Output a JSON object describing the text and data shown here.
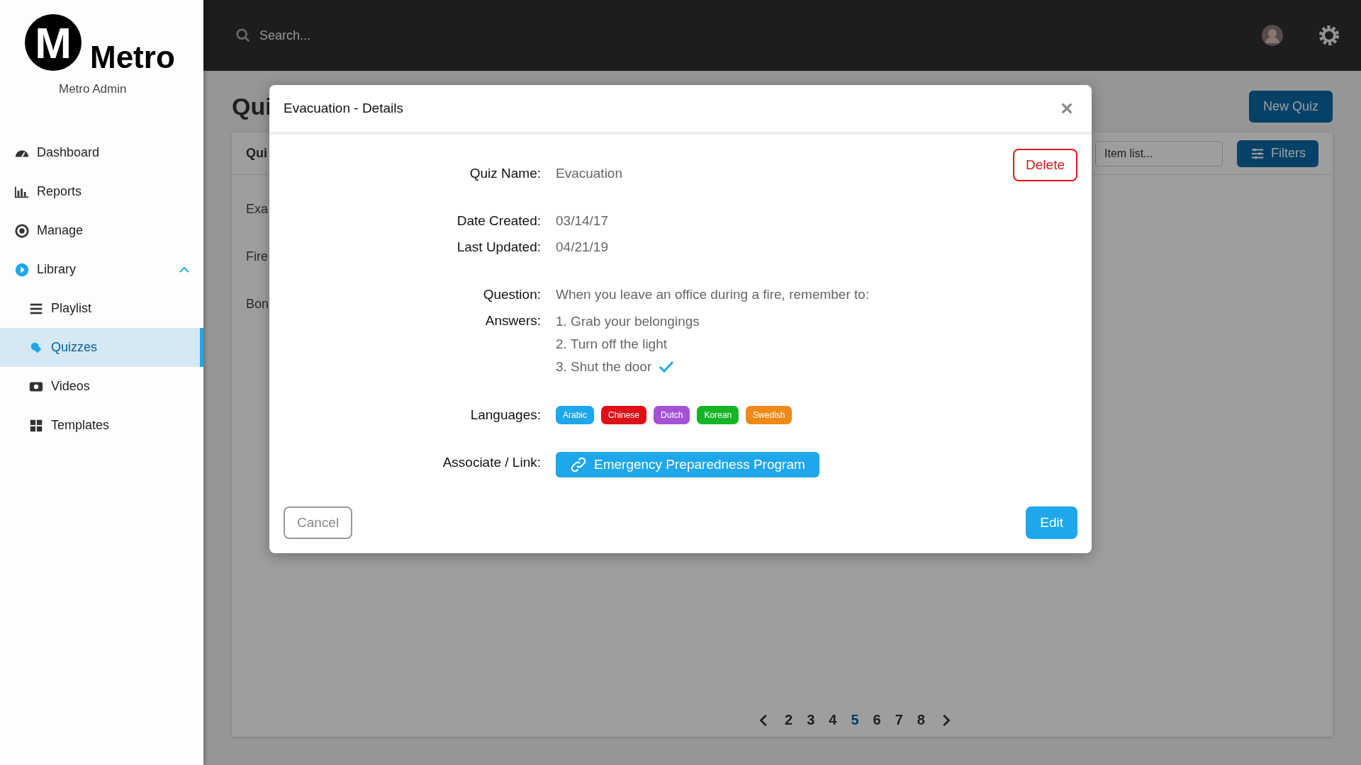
{
  "sidebar": {
    "logo_mark": "M",
    "logo_text": "Metro",
    "subtitle": "Metro Admin",
    "items": [
      {
        "label": "Dashboard",
        "selected": false
      },
      {
        "label": "Reports",
        "selected": false
      },
      {
        "label": "Manage",
        "selected": false
      },
      {
        "label": "Library",
        "selected": false,
        "expanded": true,
        "children": [
          {
            "label": "Playlist",
            "selected": false
          },
          {
            "label": "Quizzes",
            "selected": true
          },
          {
            "label": "Videos",
            "selected": false
          },
          {
            "label": "Templates",
            "selected": false
          }
        ]
      }
    ]
  },
  "topbar": {
    "search": {
      "placeholder": "Search..."
    }
  },
  "page": {
    "title": "Qui",
    "new_button": "New Quiz",
    "table": {
      "column_1": "Qui",
      "search": {
        "placeholder": "Item list..."
      },
      "filters_button": "Filters",
      "rows": [
        "Exa",
        "Fire",
        "Bon"
      ]
    },
    "pagination": {
      "pages": [
        {
          "label": "2",
          "selected": false
        },
        {
          "label": "3",
          "selected": false
        },
        {
          "label": "4",
          "selected": false
        },
        {
          "label": "5",
          "selected": true
        },
        {
          "label": "6",
          "selected": false
        },
        {
          "label": "7",
          "selected": false
        },
        {
          "label": "8",
          "selected": false
        }
      ]
    }
  },
  "modal": {
    "title": "Evacuation - Details",
    "delete_button": "Delete",
    "sections": [
      [
        {
          "kind": "text",
          "label": "Quiz Name:",
          "value": "Evacuation"
        }
      ],
      [
        {
          "kind": "text",
          "label": "Date Created:",
          "value": "03/14/17"
        },
        {
          "kind": "text",
          "label": "Last Updated:",
          "value": "04/21/19"
        }
      ],
      [
        {
          "kind": "text",
          "label": "Question:",
          "value": "When you leave an office during a fire, remember to:"
        },
        {
          "kind": "answers",
          "label": "Answers:",
          "answers": [
            {
              "text": "1. Grab your belongings",
              "correct": false
            },
            {
              "text": "2. Turn off the light",
              "correct": false
            },
            {
              "text": "3. Shut the door",
              "correct": true
            }
          ]
        }
      ],
      [
        {
          "kind": "languages",
          "label": "Languages:",
          "tags": [
            {
              "label": "Arabic",
              "color": "#1ea7ea"
            },
            {
              "label": "Chinese",
              "color": "#dd0f17"
            },
            {
              "label": "Dutch",
              "color": "#a552d6"
            },
            {
              "label": "Korean",
              "color": "#16b526"
            },
            {
              "label": "Swedish",
              "color": "#ef8a17"
            }
          ]
        }
      ],
      [
        {
          "kind": "link",
          "label": "Associate / Link:",
          "value": "Emergency Preparedness Program"
        }
      ]
    ],
    "cancel_button": "Cancel",
    "edit_button": "Edit"
  }
}
